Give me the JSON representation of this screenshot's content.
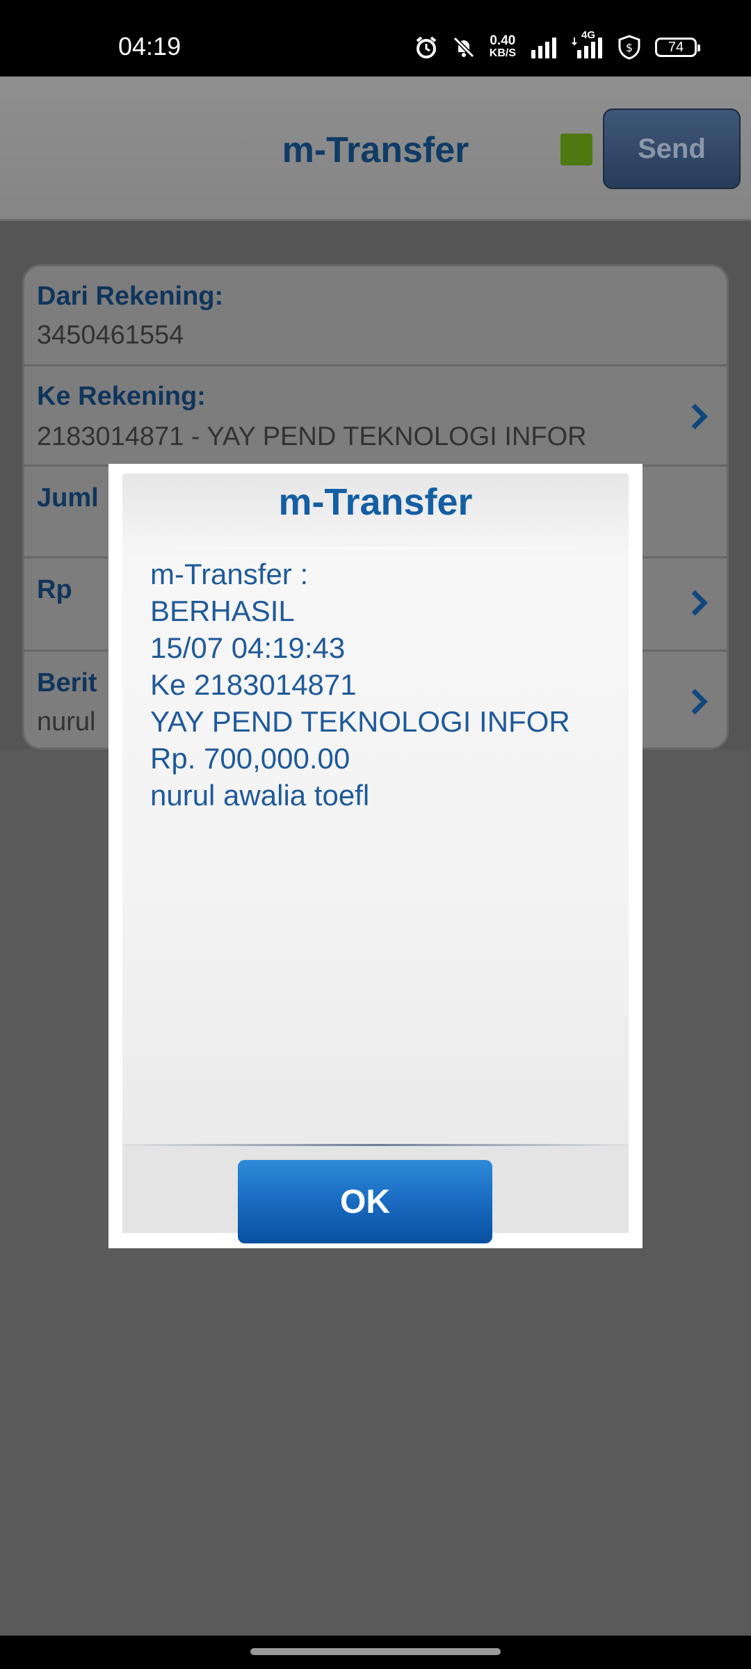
{
  "status_bar": {
    "time": "04:19",
    "net_speed_value": "0.40",
    "net_speed_unit": "KB/S",
    "network_type": "4G",
    "battery_level": "74"
  },
  "header": {
    "title": "m-Transfer",
    "send_label": "Send",
    "indicator_color": "#4d7a10"
  },
  "form": {
    "from_label": "Dari Rekening:",
    "from_value": "3450461554",
    "to_label": "Ke Rekening:",
    "to_value": "2183014871 - YAY PEND TEKNOLOGI INFOR",
    "amount_label": "Juml",
    "currency_label": "Rp",
    "message_label": "Berit",
    "message_value": "nurul"
  },
  "dialog": {
    "title": "m-Transfer",
    "lines": [
      "m-Transfer :",
      "BERHASIL",
      "15/07 04:19:43",
      "Ke 2183014871",
      "YAY PEND TEKNOLOGI INFOR",
      "Rp. 700,000.00",
      "nurul awalia toefl"
    ],
    "ok_label": "OK"
  }
}
